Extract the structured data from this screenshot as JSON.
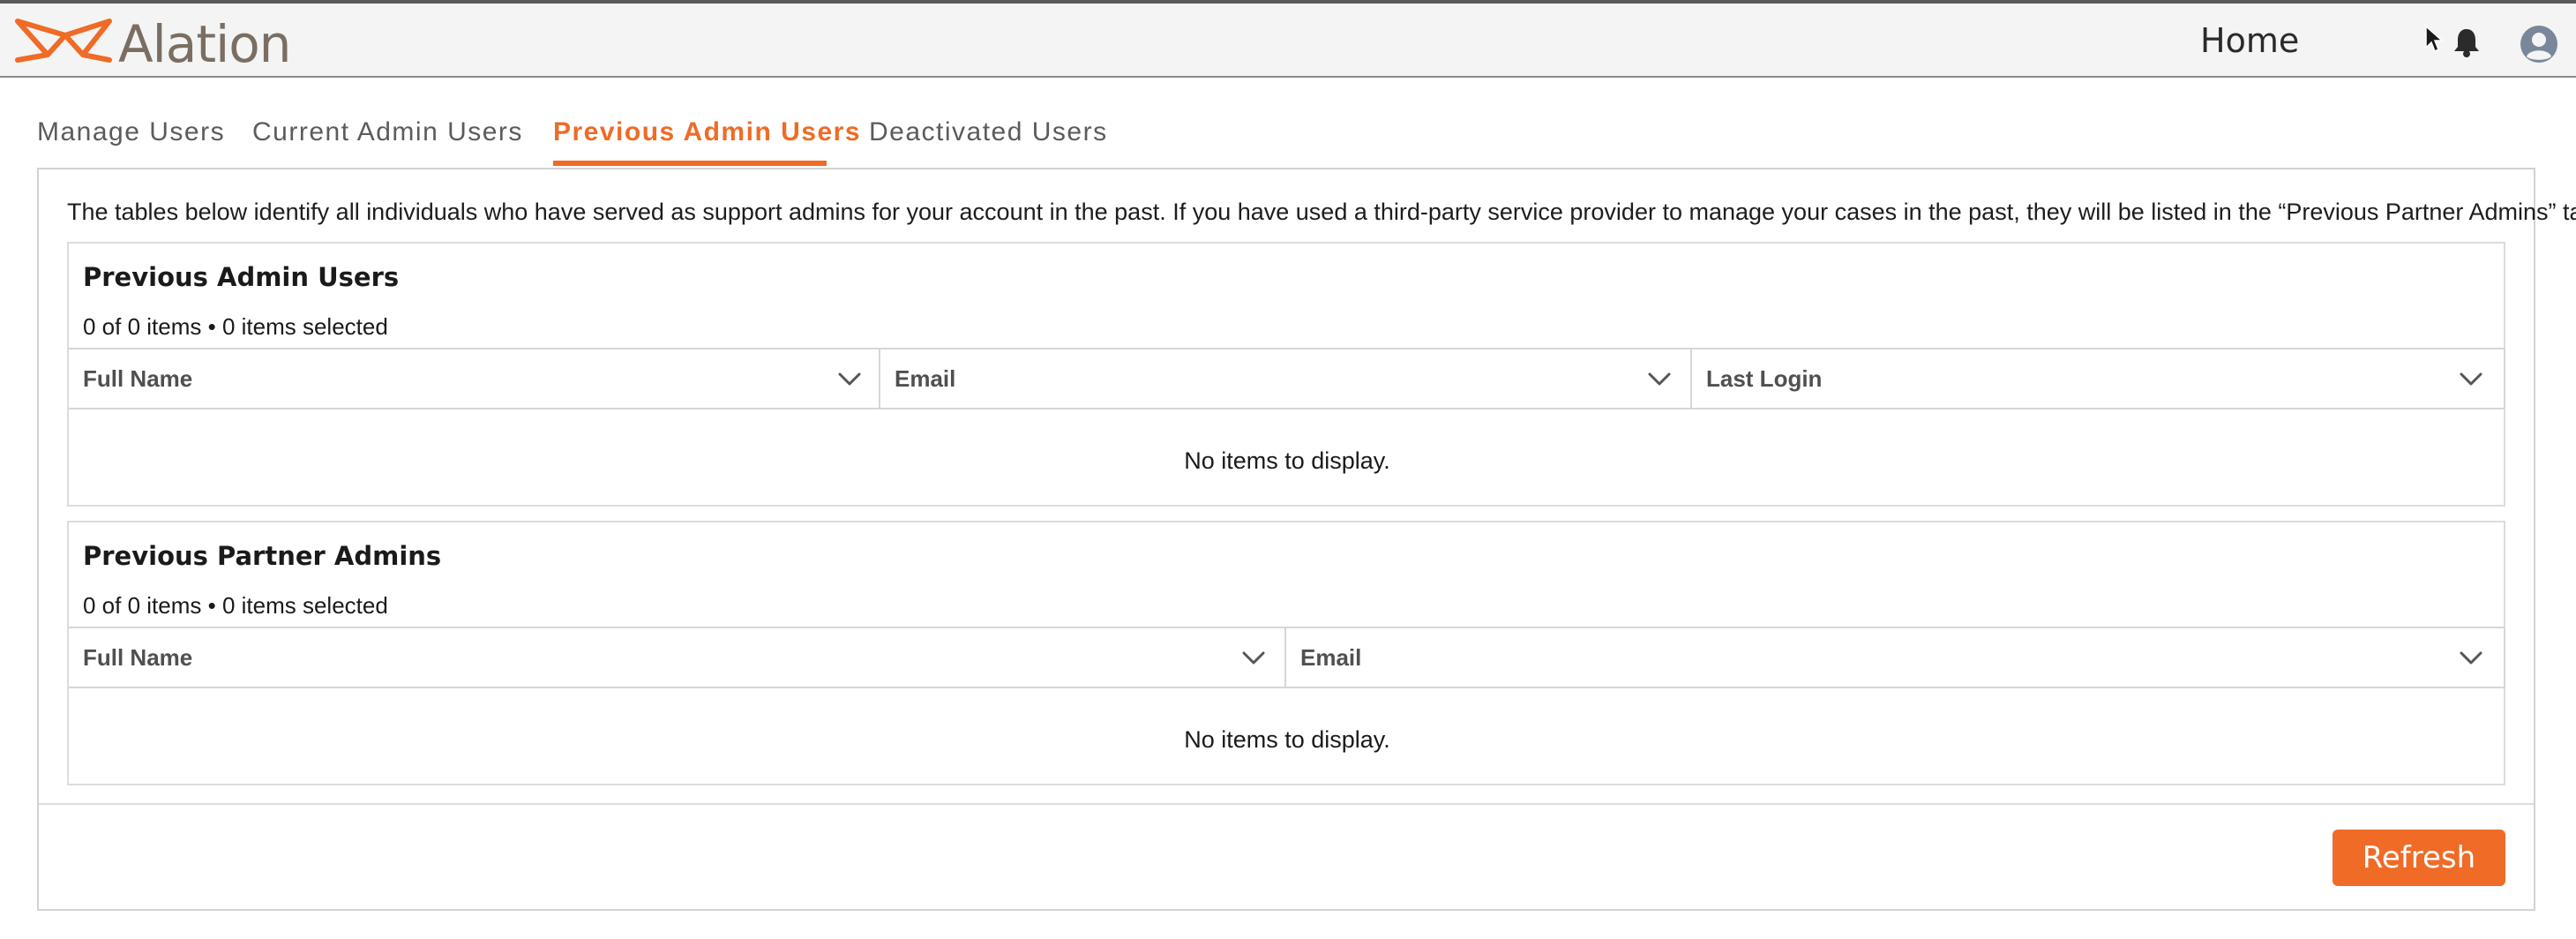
{
  "header": {
    "logo_text": "Alation",
    "title": "Home",
    "icons": [
      "alation-logo-icon",
      "cursor-icon",
      "bell-icon",
      "user-avatar-icon"
    ]
  },
  "colors": {
    "accent": "#ef6b26",
    "header_bg": "#f4f4f4",
    "border": "#d2d2d2"
  },
  "tabs": [
    {
      "label": "Manage Users",
      "active": false
    },
    {
      "label": "Current Admin Users",
      "active": false
    },
    {
      "label": "Previous Admin Users",
      "active": true
    },
    {
      "label": "Deactivated Users",
      "active": false
    }
  ],
  "intro": "The tables below identify all individuals who have served as support admins for your account in the past. If you have used a third-party service provider to manage your cases in the past, they will be listed in the “Previous Partner Admins” table.",
  "previous_admins": {
    "title": "Previous Admin Users",
    "count": "0 of 0 items • 0 items selected",
    "columns": [
      "Full Name",
      "Email",
      "Last Login"
    ],
    "empty": "No items to display."
  },
  "partner_admins": {
    "title": "Previous Partner Admins",
    "count": "0 of 0 items • 0 items selected",
    "columns": [
      "Full Name",
      "Email"
    ],
    "empty": "No items to display."
  },
  "refresh_label": "Refresh"
}
